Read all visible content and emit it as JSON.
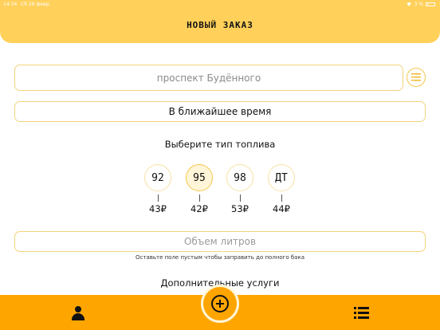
{
  "status": {
    "time": "14:34",
    "date": "Сб 29 февр.",
    "battery": "3 %"
  },
  "header": {
    "title": "НОВЫЙ ЗАКАЗ"
  },
  "address": {
    "placeholder": "проспект Будённого"
  },
  "delivery_time": {
    "value": "В ближайшее время"
  },
  "fuel": {
    "title": "Выберите тип топлива",
    "selected": "95",
    "options": [
      {
        "label": "92",
        "price": "43₽"
      },
      {
        "label": "95",
        "price": "42₽"
      },
      {
        "label": "98",
        "price": "53₽"
      },
      {
        "label": "ДТ",
        "price": "44₽"
      }
    ]
  },
  "liters": {
    "placeholder": "Объем литров",
    "hint": "Оставьте поле пустым чтобы заправить до полного бака"
  },
  "extras": {
    "title": "Дополнительные услуги"
  },
  "icons": {
    "address_list": "list-icon",
    "profile": "user-icon",
    "add": "plus-circle-icon",
    "orders": "menu-list-icon"
  },
  "colors": {
    "header": "#ffd05a",
    "bottom_bar": "#ffa500",
    "accent_border": "#f4d37c"
  }
}
